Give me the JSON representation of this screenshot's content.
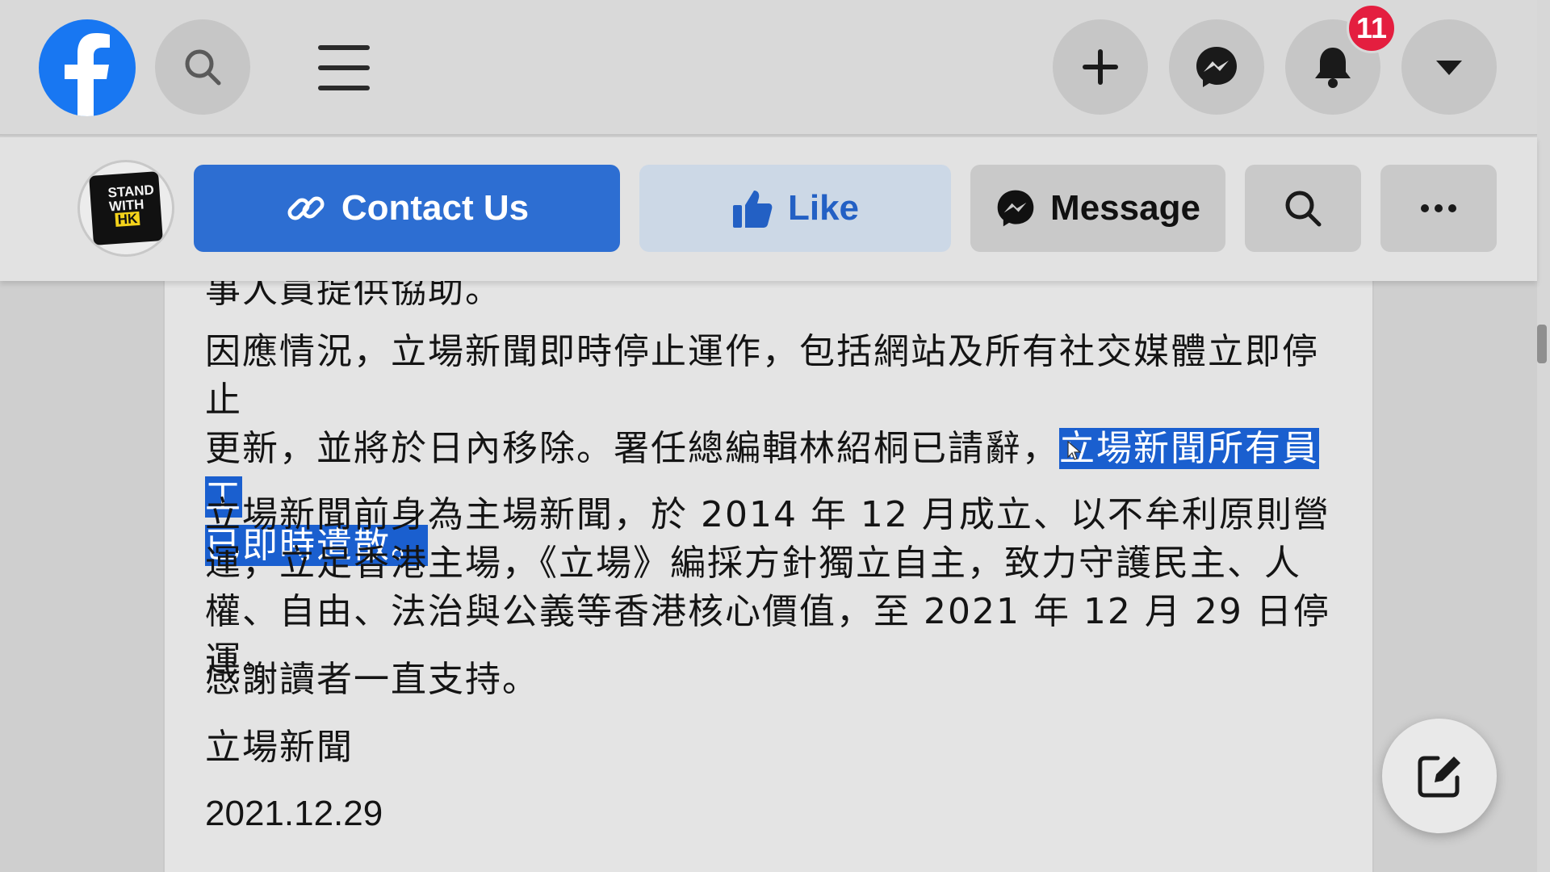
{
  "topbar": {
    "logo": "facebook-logo",
    "icons": [
      "search-icon",
      "menu-icon",
      "plus-icon",
      "messenger-icon",
      "bell-icon",
      "caret-down-icon"
    ],
    "notification_count": "11"
  },
  "page_actions": {
    "avatar_text": "STAND WITH",
    "avatar_tag": "HK",
    "contact_label": "Contact Us",
    "like_label": "Like",
    "message_label": "Message",
    "search_icon": "search-icon",
    "more_icon": "more-icon"
  },
  "post": {
    "cut_line": "事人員提供協助。",
    "para1_plain": "因應情況，立場新聞即時停止運作，包括網站及所有社交媒體立即停止\n更新，並將於日內移除。署任總編輯林紹桐已請辭，",
    "para1_highlight": "立場新聞所有員工\n已即時遣散。",
    "para2": "立場新聞前身為主場新聞，於 2014 年 12 月成立、以不牟利原則營\n運，立足香港主場，《立場》編採方針獨立自主，致力守護民主、人\n權、自由、法治與公義等香港核心價值，至 2021 年 12 月 29 日停運。",
    "para3": "感謝讀者一直支持。",
    "para4": "立場新聞",
    "para5": "2021.12.29"
  },
  "colors": {
    "facebook_blue": "#1877f2",
    "primary_button": "#2d6ed2",
    "highlight": "#1a5fcf",
    "badge": "#e41e3f"
  },
  "floating": {
    "compose_icon": "compose-icon"
  }
}
